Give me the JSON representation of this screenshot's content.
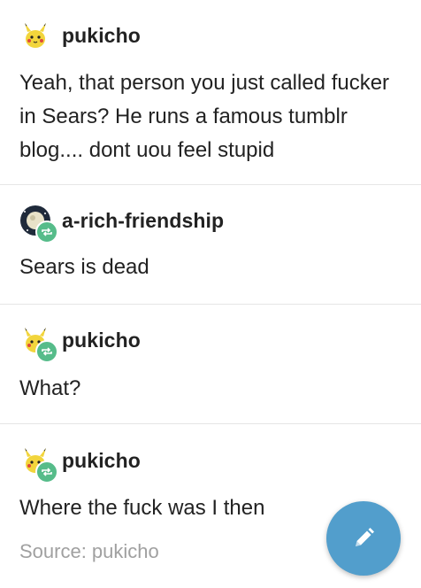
{
  "posts": [
    {
      "username": "pukicho",
      "avatar_icon": "pikachu-avatar-icon",
      "reblogged": false,
      "text": "Yeah, that person you just called fucker in Sears? He runs a famous tumblr blog.... dont uou feel stupid"
    },
    {
      "username": "a-rich-friendship",
      "avatar_icon": "planet-avatar-icon",
      "reblogged": true,
      "text": "Sears is dead"
    },
    {
      "username": "pukicho",
      "avatar_icon": "pikachu-avatar-icon",
      "reblogged": true,
      "text": "What?"
    },
    {
      "username": "pukicho",
      "avatar_icon": "pikachu-avatar-icon",
      "reblogged": true,
      "text": "Where the fuck was I then"
    }
  ],
  "source": {
    "label": "Source: pukicho"
  },
  "fab": {
    "icon": "pencil-icon",
    "color": "#529ecc"
  },
  "colors": {
    "reblog_badge": "#56bc8a",
    "divider": "#e6e6e6"
  }
}
